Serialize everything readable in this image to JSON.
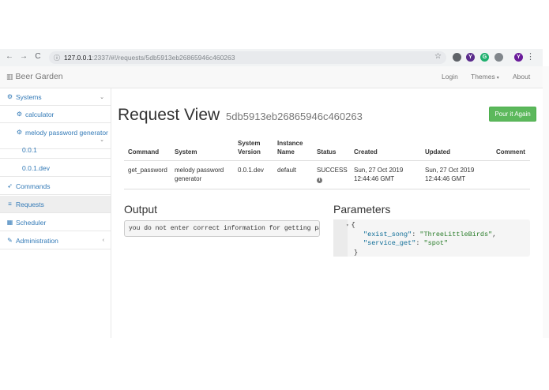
{
  "browser": {
    "url_host": "127.0.0.1",
    "url_rest": ":2337/#!/requests/5db5913eb26865946c460263",
    "back_glyph": "←",
    "forward_glyph": "→",
    "reload_glyph": "C",
    "info_glyph": "ⓘ",
    "star_glyph": "☆",
    "menu_glyph": "⋮",
    "extensions": [
      {
        "name": "ext-icon-1",
        "label": "",
        "color": "#5f6368"
      },
      {
        "name": "ext-icon-2",
        "label": "Y",
        "color": "#5b2c8c"
      },
      {
        "name": "ext-icon-3",
        "label": "G",
        "color": "#1fb06e"
      },
      {
        "name": "ext-icon-4",
        "label": "",
        "color": "#80868b"
      },
      {
        "name": "profile-avatar",
        "label": "Y",
        "color": "#6a1b9a"
      }
    ]
  },
  "navbar": {
    "brand": "Beer Garden",
    "brand_icon": "▥",
    "links": {
      "login": "Login",
      "themes": "Themes",
      "about": "About"
    },
    "caret": "▾"
  },
  "sidebar": {
    "items": [
      {
        "label": "Systems",
        "icon": "⚙",
        "chevron": "⌄"
      },
      {
        "label": "calculator",
        "icon": "⚙"
      },
      {
        "label": "melody password generator",
        "icon": "⚙",
        "chevron": "⌄"
      },
      {
        "label": "0.0.1"
      },
      {
        "label": "0.0.1.dev"
      },
      {
        "label": "Commands",
        "icon": "➶"
      },
      {
        "label": "Requests",
        "icon": "≡"
      },
      {
        "label": "Scheduler",
        "icon": "▦"
      },
      {
        "label": "Administration",
        "icon": "✎",
        "chevron": "‹"
      }
    ],
    "active": "Requests"
  },
  "main": {
    "title": "Request View",
    "request_id": "5db5913eb26865946c460263",
    "pour_button": "Pour it Again",
    "table": {
      "headers": [
        {
          "line1": "Command",
          "line2": ""
        },
        {
          "line1": "System",
          "line2": ""
        },
        {
          "line1": "System",
          "line2": "Version"
        },
        {
          "line1": "Instance",
          "line2": "Name"
        },
        {
          "line1": "Status",
          "line2": ""
        },
        {
          "line1": "Created",
          "line2": ""
        },
        {
          "line1": "Updated",
          "line2": ""
        },
        {
          "line1": "Comment",
          "line2": ""
        }
      ],
      "row": {
        "command": "get_password",
        "system_line1": "melody password",
        "system_line2": "generator",
        "system_version": "0.0.1.dev",
        "instance_name": "default",
        "status": "SUCCESS",
        "status_info": "i",
        "created_line1": "Sun, 27 Oct 2019",
        "created_line2": "12:44:46 GMT",
        "updated_line1": "Sun, 27 Oct 2019",
        "updated_line2": "12:44:46 GMT",
        "comment": ""
      }
    },
    "output": {
      "heading": "Output",
      "text": "you do not enter correct information for getting pa"
    },
    "parameters": {
      "heading": "Parameters",
      "fold_glyph": "▾",
      "open_brace": "{",
      "close_brace": "}",
      "entries": [
        {
          "key": "\"exist_song\"",
          "value": "\"ThreeLittleBirds\"",
          "sep": ","
        },
        {
          "key": "\"service_get\"",
          "value": "\"spot\"",
          "sep": ""
        }
      ]
    }
  }
}
